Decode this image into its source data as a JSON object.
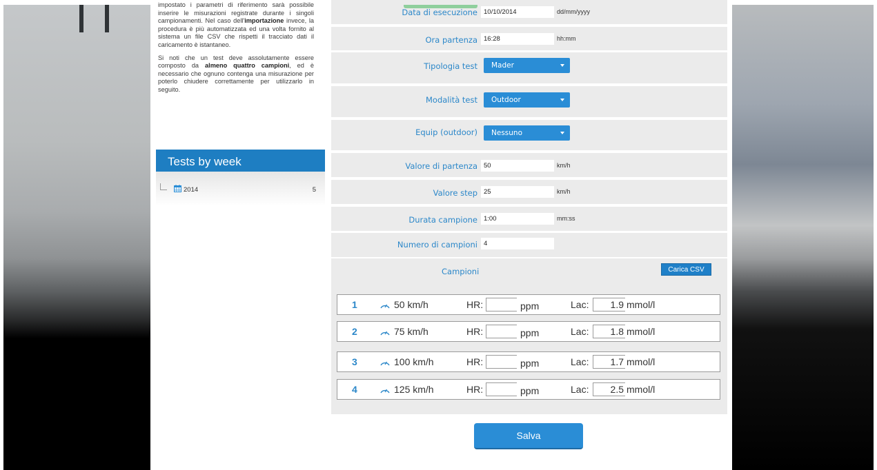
{
  "intro": {
    "p1_parts": [
      "impostato i parametri di riferimento sarà possibile inserire le misurazioni registrate durante i singoli campionamenti. Nel caso dell'",
      "importazione",
      " invece, la procedura è più automatizzata ed una volta fornito al sistema un file CSV che rispetti il tracciato dati il caricamento è istantaneo."
    ],
    "p2_parts": [
      "Si noti che un test deve assolutamente essere composto da ",
      "almeno quattro campioni",
      ", ed è necessario che ognuno contenga una misurazione per poterlo chiudere correttamente per utilizzarlo in seguito."
    ]
  },
  "weeks": {
    "title": "Tests by week",
    "tree": [
      {
        "year": "2014",
        "count": "5"
      }
    ]
  },
  "form": {
    "fields": [
      {
        "label": "Data di esecuzione",
        "value": "10/10/2014",
        "unit": "dd/mm/yyyy"
      },
      {
        "label": "Ora partenza",
        "value": "16:28",
        "unit": "hh:mm"
      },
      {
        "label": "Tipologia test",
        "select": "Mader"
      },
      {
        "label": "Modalità test",
        "select": "Outdoor"
      },
      {
        "label": "Equip (outdoor)",
        "select": "Nessuno"
      },
      {
        "label": "Valore di partenza",
        "value": "50",
        "unit": "km/h"
      },
      {
        "label": "Valore step",
        "value": "25",
        "unit": "km/h"
      },
      {
        "label": "Durata campione",
        "value": "1:00",
        "unit": "mm:ss"
      },
      {
        "label": "Numero di campioni",
        "value": "4"
      }
    ],
    "samples_title": "Campioni",
    "csv_button": "Carica CSV",
    "samples": [
      {
        "n": "1",
        "speed": "50 km/h",
        "hr_label": "HR:",
        "hr": "",
        "ppm": "ppm",
        "lac_label": "Lac:",
        "lac": "1.9",
        "lac_unit": "mmol/l"
      },
      {
        "n": "2",
        "speed": "75 km/h",
        "hr_label": "HR:",
        "hr": "",
        "ppm": "ppm",
        "lac_label": "Lac:",
        "lac": "1.8",
        "lac_unit": "mmol/l"
      },
      {
        "n": "3",
        "speed": "100 km/h",
        "hr_label": "HR:",
        "hr": "",
        "ppm": "ppm",
        "lac_label": "Lac:",
        "lac": "1.7",
        "lac_unit": "mmol/l"
      },
      {
        "n": "4",
        "speed": "125 km/h",
        "hr_label": "HR:",
        "hr": "",
        "ppm": "ppm",
        "lac_label": "Lac:",
        "lac": "2.5",
        "lac_unit": "mmol/l"
      }
    ],
    "save_button": "Salva"
  },
  "colors": {
    "accent": "#2a8dd6",
    "label": "#2b87c9",
    "panel": "#ebebeb"
  },
  "icons": {
    "calendar": "calendar-icon",
    "speed": "speedometer-icon",
    "dropdown": "chevron-down-icon"
  }
}
